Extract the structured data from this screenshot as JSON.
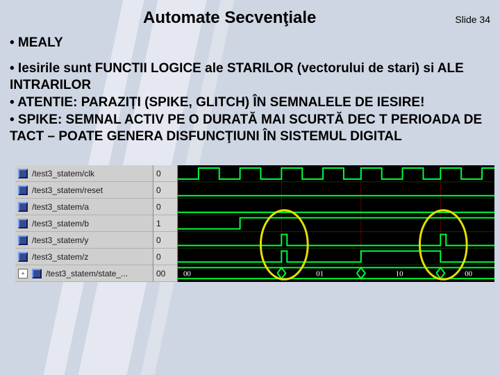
{
  "title": "Automate Secvenţiale",
  "slide_label": "Slide 34",
  "heading": "• MEALY",
  "bullets": [
    "• Iesirile sunt FUNCTII LOGICE  ale STARILOR (vectorului de stari) si ALE INTRARILOR",
    "• ATENTIE: PARAZIȚI (SPIKE, GLITCH) ÎN SEMNALELE DE IESIRE!",
    "• SPIKE: SEMNAL ACTIV PE O DURATĂ MAI SCURTĂ DEC T PERIOADA DE TACT – POATE GENERA DISFUNCŢIUNI ÎN SISTEMUL DIGITAL"
  ],
  "signals": [
    {
      "name": "/test3_statem/clk",
      "value": "0"
    },
    {
      "name": "/test3_statem/reset",
      "value": "0"
    },
    {
      "name": "/test3_statem/a",
      "value": "0"
    },
    {
      "name": "/test3_statem/b",
      "value": "1"
    },
    {
      "name": "/test3_statem/y",
      "value": "0"
    },
    {
      "name": "/test3_statem/z",
      "value": "0"
    },
    {
      "name": "/test3_statem/state_...",
      "value": "00"
    }
  ],
  "state_sequence": [
    "00",
    "01",
    "10",
    "00"
  ]
}
